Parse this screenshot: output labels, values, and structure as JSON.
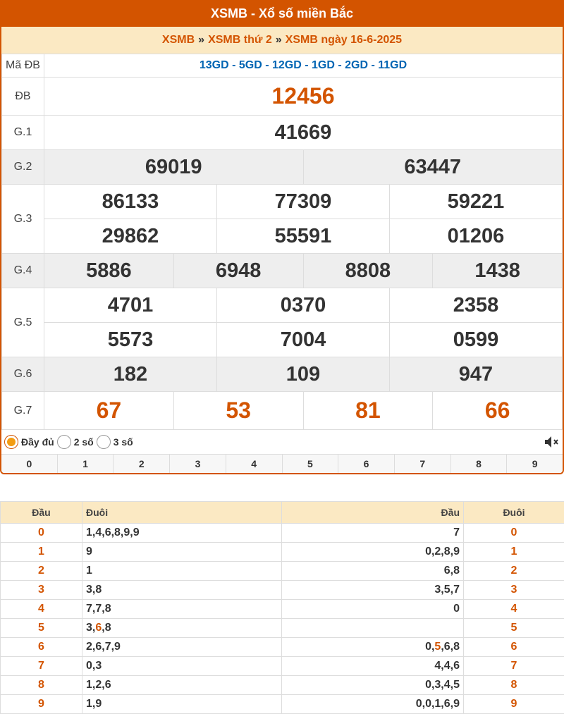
{
  "header": {
    "title": "XSMB - Xổ số miền Bắc"
  },
  "breadcrumb": {
    "item1": "XSMB",
    "item2": "XSMB thứ 2",
    "item3": "XSMB ngày 16-6-2025",
    "separator": "»"
  },
  "results": {
    "madb_label": "Mã ĐB",
    "madb_value": "13GD - 5GD - 12GD - 1GD - 2GD - 11GD",
    "db_label": "ĐB",
    "db": "12456",
    "g1_label": "G.1",
    "g1": "41669",
    "g2_label": "G.2",
    "g2": [
      "69019",
      "63447"
    ],
    "g3_label": "G.3",
    "g3": [
      "86133",
      "77309",
      "59221",
      "29862",
      "55591",
      "01206"
    ],
    "g4_label": "G.4",
    "g4": [
      "5886",
      "6948",
      "8808",
      "1438"
    ],
    "g5_label": "G.5",
    "g5": [
      "4701",
      "0370",
      "2358",
      "5573",
      "7004",
      "0599"
    ],
    "g6_label": "G.6",
    "g6": [
      "182",
      "109",
      "947"
    ],
    "g7_label": "G.7",
    "g7": [
      "67",
      "53",
      "81",
      "66"
    ]
  },
  "options": {
    "full": "Đầy đủ",
    "two": "2 số",
    "three": "3 số",
    "selected": "full"
  },
  "digits": [
    "0",
    "1",
    "2",
    "3",
    "4",
    "5",
    "6",
    "7",
    "8",
    "9"
  ],
  "loto": {
    "head_dau": "Đầu",
    "head_duoi": "Đuôi",
    "rows": [
      {
        "dau": "0",
        "duoi": "1,4,6,8,9,9",
        "rev": "7"
      },
      {
        "dau": "1",
        "duoi": "9",
        "rev": "0,2,8,9"
      },
      {
        "dau": "2",
        "duoi": "1",
        "rev": "6,8"
      },
      {
        "dau": "3",
        "duoi": "3,8",
        "rev": "3,5,7"
      },
      {
        "dau": "4",
        "duoi": "7,7,8",
        "rev": "0"
      },
      {
        "dau": "5",
        "duoi_parts": [
          "3,",
          "6",
          ",8"
        ],
        "rev": ""
      },
      {
        "dau": "6",
        "duoi": "2,6,7,9",
        "rev_parts": [
          "0,",
          "5",
          ",6,8"
        ]
      },
      {
        "dau": "7",
        "duoi": "0,3",
        "rev": "4,4,6"
      },
      {
        "dau": "8",
        "duoi": "1,2,6",
        "rev": "0,3,4,5"
      },
      {
        "dau": "9",
        "duoi": "1,9",
        "rev": "0,0,1,6,9"
      }
    ]
  },
  "colors": {
    "accent": "#d35400",
    "header_bg": "#fbe9c3",
    "madb": "#0065b3"
  },
  "icons": {
    "mute": "speaker-muted-icon"
  }
}
